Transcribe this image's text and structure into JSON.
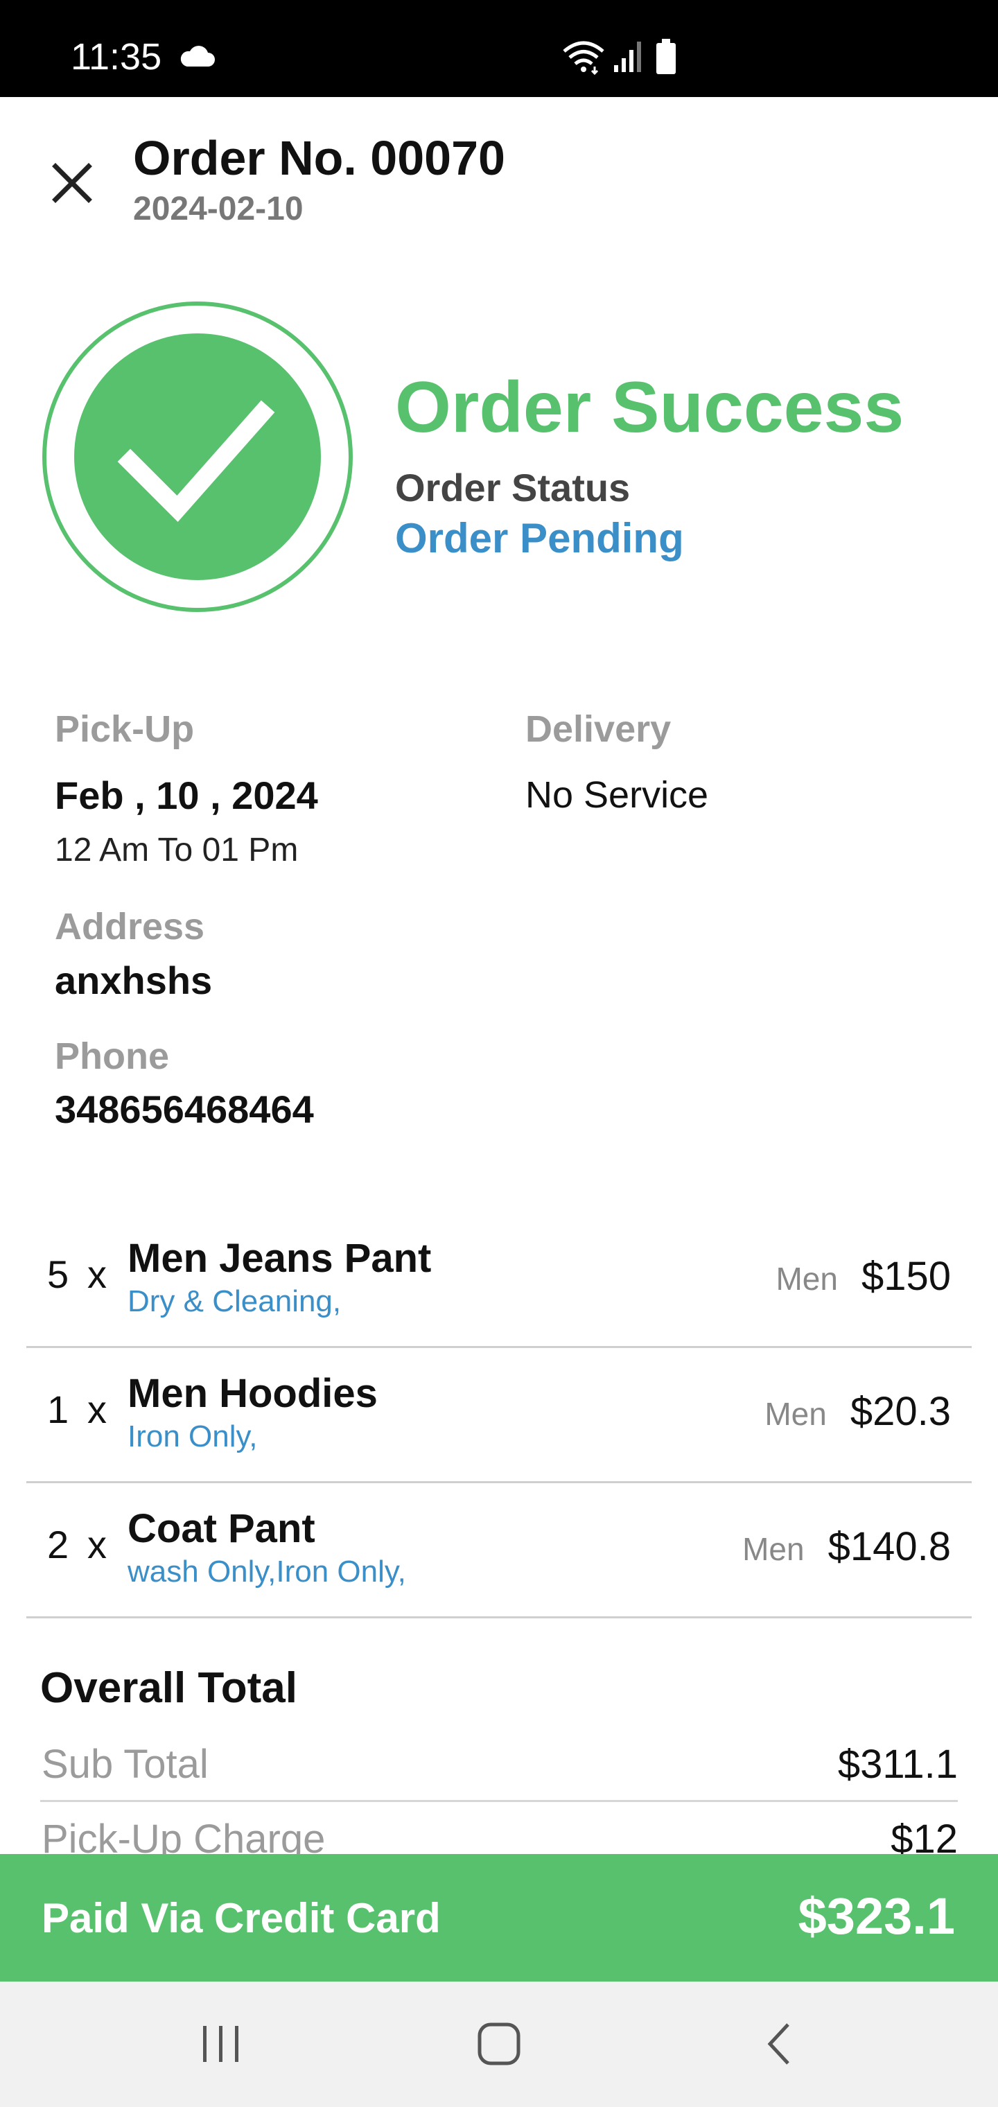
{
  "status_bar": {
    "time": "11:35"
  },
  "header": {
    "title": "Order No. 00070",
    "date": "2024-02-10",
    "close_icon": "close-icon"
  },
  "success": {
    "title": "Order Success",
    "status_label": "Order Status",
    "status_value": "Order Pending",
    "icon": "check-circle-icon"
  },
  "pickup": {
    "label": "Pick-Up",
    "date": "Feb , 10 , 2024",
    "time": "12 Am To 01 Pm"
  },
  "delivery": {
    "label": "Delivery",
    "value": "No Service"
  },
  "address": {
    "label": "Address",
    "value": "anxhshs"
  },
  "phone": {
    "label": "Phone",
    "value": "348656468464"
  },
  "items": [
    {
      "qty": "5",
      "x": "x",
      "name": "Men Jeans Pant",
      "service": "Dry & Cleaning,",
      "category": "Men",
      "price": "$150"
    },
    {
      "qty": "1",
      "x": "x",
      "name": "Men Hoodies",
      "service": "Iron Only,",
      "category": "Men",
      "price": "$20.3"
    },
    {
      "qty": "2",
      "x": "x",
      "name": "Coat Pant",
      "service": "wash Only,Iron Only,",
      "category": "Men",
      "price": "$140.8"
    }
  ],
  "totals": {
    "title": "Overall Total",
    "rows": [
      {
        "label": "Sub Total",
        "value": "$311.1"
      },
      {
        "label": "Pick-Up Charge",
        "value": "$12"
      }
    ]
  },
  "payment": {
    "method": "Paid Via Credit Card",
    "total": "$323.1"
  },
  "colors": {
    "accent_green": "#58c16e",
    "link_blue": "#3b8fc8"
  }
}
